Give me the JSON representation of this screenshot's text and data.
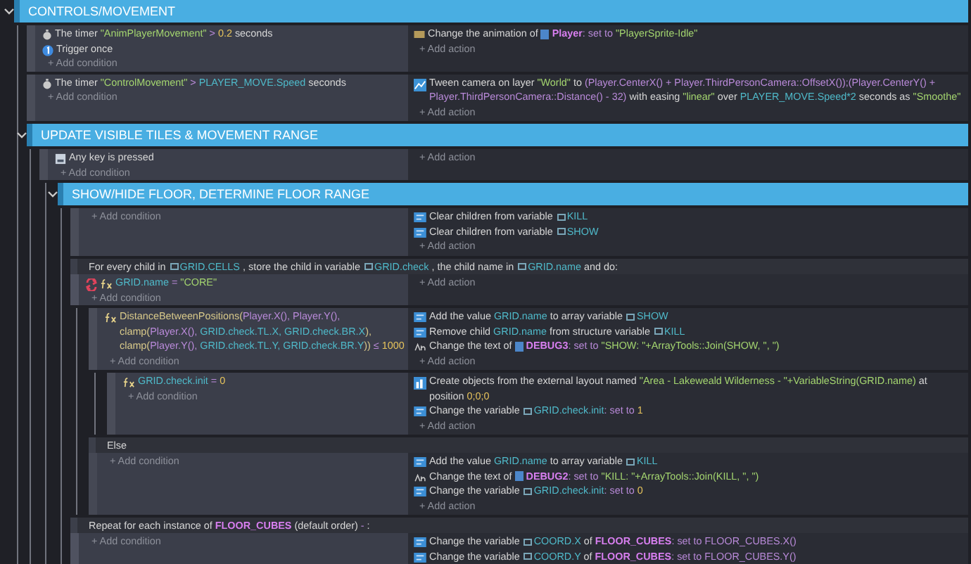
{
  "events": [
    {
      "kind": "group",
      "title": "CONTROLS/MOVEMENT",
      "expanded": true,
      "children": [
        {
          "kind": "event",
          "add_condition": "+ Add condition",
          "add_action": "+ Add action",
          "conditions": [
            {
              "kind": "timer",
              "inverted": false,
              "parts": [
                {
                  "kind": "text",
                  "text": "The timer "
                },
                {
                  "kind": "string",
                  "text": "\"AnimPlayerMovement\""
                },
                {
                  "kind": "operator",
                  "text": " > "
                },
                {
                  "kind": "number",
                  "text": "0.2"
                },
                {
                  "kind": "text",
                  "text": " seconds"
                }
              ]
            },
            {
              "kind": "trigger",
              "inverted": false,
              "parts": [
                {
                  "kind": "text",
                  "text": "Trigger once"
                }
              ]
            }
          ],
          "actions": [
            {
              "kind": "animation",
              "parts": [
                {
                  "kind": "text",
                  "text": "Change the animation of "
                },
                {
                  "kind": "objref",
                  "text": "Player"
                },
                {
                  "kind": "operator",
                  "text": ": set to "
                },
                {
                  "kind": "string",
                  "text": "\"PlayerSprite-Idle\""
                }
              ]
            }
          ]
        },
        {
          "kind": "event",
          "add_condition": "+ Add condition",
          "add_action": "+ Add action",
          "conditions": [
            {
              "kind": "timer",
              "inverted": false,
              "parts": [
                {
                  "kind": "text",
                  "text": "The timer "
                },
                {
                  "kind": "string",
                  "text": "\"ControlMovement\""
                },
                {
                  "kind": "operator",
                  "text": " > "
                },
                {
                  "kind": "variable",
                  "text": "PLAYER_MOVE.Speed"
                },
                {
                  "kind": "text",
                  "text": " seconds"
                }
              ]
            }
          ],
          "actions": [
            {
              "kind": "tween",
              "parts": [
                {
                  "kind": "text",
                  "text": "Tween camera on layer "
                },
                {
                  "kind": "string",
                  "text": "\"World\""
                },
                {
                  "kind": "text",
                  "text": " to "
                },
                {
                  "kind": "expression",
                  "text": "(Player.CenterX() + Player.ThirdPersonCamera::OffsetX());(Player.CenterY() + Player.ThirdPersonCamera::Distance() - 32)"
                },
                {
                  "kind": "text",
                  "text": " with easing "
                },
                {
                  "kind": "string",
                  "text": "\"linear\""
                },
                {
                  "kind": "text",
                  "text": " over "
                },
                {
                  "kind": "variable",
                  "text": "PLAYER_MOVE.Speed*2"
                },
                {
                  "kind": "text",
                  "text": " seconds as "
                },
                {
                  "kind": "string",
                  "text": "\"Smoothe\""
                }
              ]
            }
          ]
        },
        {
          "kind": "group",
          "title": "UPDATE VISIBLE TILES & MOVEMENT RANGE",
          "expanded": true,
          "children": [
            {
              "kind": "event",
              "add_condition": "+ Add condition",
              "add_action": "+ Add action",
              "conditions": [
                {
                  "kind": "key",
                  "inverted": false,
                  "parts": [
                    {
                      "kind": "text",
                      "text": "Any key is pressed"
                    }
                  ]
                }
              ],
              "children": [
                {
                  "kind": "group",
                  "title": "SHOW/HIDE FLOOR, DETERMINE FLOOR RANGE",
                  "expanded": true,
                  "children": [
                    {
                      "kind": "event",
                      "add_condition": "+ Add condition",
                      "add_action": "+ Add action",
                      "actions": [
                        {
                          "kind": "variable",
                          "parts": [
                            {
                              "kind": "text",
                              "text": "Clear children from variable "
                            },
                            {
                              "kind": "varref",
                              "text": "KILL"
                            }
                          ]
                        },
                        {
                          "kind": "variable",
                          "parts": [
                            {
                              "kind": "text",
                              "text": "Clear children from variable "
                            },
                            {
                              "kind": "varref",
                              "text": "SHOW"
                            }
                          ]
                        }
                      ]
                    },
                    {
                      "kind": "loop",
                      "add_condition": "+ Add condition",
                      "add_action": "+ Add action",
                      "header": [
                        {
                          "kind": "text",
                          "text": "For every child in "
                        },
                        {
                          "kind": "varref",
                          "text": "GRID.CELLS"
                        },
                        {
                          "kind": "text",
                          "text": " , store the child in variable "
                        },
                        {
                          "kind": "varref",
                          "text": "GRID.check"
                        },
                        {
                          "kind": "text",
                          "text": " , the child name in "
                        },
                        {
                          "kind": "varref",
                          "text": "GRID.name"
                        },
                        {
                          "kind": "text",
                          "text": " and do:"
                        }
                      ],
                      "conditions": [
                        {
                          "kind": "expression",
                          "inverted": true,
                          "parts": [
                            {
                              "kind": "variable",
                              "text": "GRID.name"
                            },
                            {
                              "kind": "operator",
                              "text": " = "
                            },
                            {
                              "kind": "string",
                              "text": "\"CORE\""
                            }
                          ]
                        }
                      ],
                      "children": [
                        {
                          "kind": "event",
                          "add_condition": "+ Add condition",
                          "add_action": "+ Add action",
                          "conditions": [
                            {
                              "kind": "expression",
                              "inverted": false,
                              "parts": [
                                {
                                  "kind": "function",
                                  "text": "DistanceBetweenPositions("
                                },
                                {
                                  "kind": "expression",
                                  "text": "Player.X(), Player.Y(), "
                                },
                                {
                                  "kind": "function",
                                  "text": "clamp("
                                },
                                {
                                  "kind": "expression",
                                  "text": "Player.X(), "
                                },
                                {
                                  "kind": "variable",
                                  "text": "GRID.check.TL.X, GRID.check.BR.X"
                                },
                                {
                                  "kind": "function",
                                  "text": "), clamp("
                                },
                                {
                                  "kind": "expression",
                                  "text": "Player.Y(), "
                                },
                                {
                                  "kind": "variable",
                                  "text": "GRID.check.TL.Y, GRID.check.BR.Y"
                                },
                                {
                                  "kind": "function",
                                  "text": "))"
                                },
                                {
                                  "kind": "operator",
                                  "text": " ≤ "
                                },
                                {
                                  "kind": "number",
                                  "text": "1000"
                                }
                              ]
                            }
                          ],
                          "actions": [
                            {
                              "kind": "variable",
                              "parts": [
                                {
                                  "kind": "text",
                                  "text": "Add the value "
                                },
                                {
                                  "kind": "variable",
                                  "text": "GRID.name"
                                },
                                {
                                  "kind": "text",
                                  "text": " to array variable "
                                },
                                {
                                  "kind": "varref",
                                  "text": "SHOW"
                                }
                              ]
                            },
                            {
                              "kind": "variable",
                              "parts": [
                                {
                                  "kind": "text",
                                  "text": "Remove child "
                                },
                                {
                                  "kind": "variable",
                                  "text": "GRID.name"
                                },
                                {
                                  "kind": "text",
                                  "text": " from structure variable "
                                },
                                {
                                  "kind": "varref",
                                  "text": "KILL"
                                }
                              ]
                            },
                            {
                              "kind": "text",
                              "parts": [
                                {
                                  "kind": "text",
                                  "text": "Change the text of "
                                },
                                {
                                  "kind": "objref",
                                  "text": "DEBUG3"
                                },
                                {
                                  "kind": "operator",
                                  "text": ": set to "
                                },
                                {
                                  "kind": "string",
                                  "text": "\"SHOW: \"+ArrayTools::Join(SHOW, \", \")"
                                }
                              ]
                            }
                          ],
                          "children": [
                            {
                              "kind": "event",
                              "add_condition": "+ Add condition",
                              "add_action": "+ Add action",
                              "conditions": [
                                {
                                  "kind": "expression",
                                  "inverted": false,
                                  "parts": [
                                    {
                                      "kind": "variable",
                                      "text": "GRID.check.init"
                                    },
                                    {
                                      "kind": "operator",
                                      "text": " = "
                                    },
                                    {
                                      "kind": "number",
                                      "text": "0"
                                    }
                                  ]
                                }
                              ],
                              "actions": [
                                {
                                  "kind": "create",
                                  "parts": [
                                    {
                                      "kind": "text",
                                      "text": "Create objects from the external layout named "
                                    },
                                    {
                                      "kind": "string",
                                      "text": "\"Area - Lakeweald Wilderness - \"+VariableString(GRID.name)"
                                    },
                                    {
                                      "kind": "text",
                                      "text": " at position "
                                    },
                                    {
                                      "kind": "number",
                                      "text": "0;0;0"
                                    }
                                  ]
                                },
                                {
                                  "kind": "variable",
                                  "parts": [
                                    {
                                      "kind": "text",
                                      "text": "Change the variable "
                                    },
                                    {
                                      "kind": "varref",
                                      "text": "GRID.check.init"
                                    },
                                    {
                                      "kind": "operator",
                                      "text": ": set to "
                                    },
                                    {
                                      "kind": "number",
                                      "text": "1"
                                    }
                                  ]
                                }
                              ]
                            }
                          ]
                        },
                        {
                          "kind": "else",
                          "add_condition": "+ Add condition",
                          "add_action": "+ Add action",
                          "header": [
                            {
                              "kind": "text",
                              "text": "Else"
                            }
                          ],
                          "actions": [
                            {
                              "kind": "variable",
                              "parts": [
                                {
                                  "kind": "text",
                                  "text": "Add the value "
                                },
                                {
                                  "kind": "variable",
                                  "text": "GRID.name"
                                },
                                {
                                  "kind": "text",
                                  "text": " to array variable "
                                },
                                {
                                  "kind": "varref",
                                  "text": "KILL"
                                }
                              ]
                            },
                            {
                              "kind": "text",
                              "parts": [
                                {
                                  "kind": "text",
                                  "text": "Change the text of "
                                },
                                {
                                  "kind": "objref",
                                  "text": "DEBUG2"
                                },
                                {
                                  "kind": "operator",
                                  "text": ": set to "
                                },
                                {
                                  "kind": "string",
                                  "text": "\"KILL: \"+ArrayTools::Join(KILL, \", \")"
                                }
                              ]
                            },
                            {
                              "kind": "variable",
                              "parts": [
                                {
                                  "kind": "text",
                                  "text": "Change the variable "
                                },
                                {
                                  "kind": "varref",
                                  "text": "GRID.check.init"
                                },
                                {
                                  "kind": "operator",
                                  "text": ": set to "
                                },
                                {
                                  "kind": "number",
                                  "text": "0"
                                }
                              ]
                            }
                          ]
                        }
                      ]
                    },
                    {
                      "kind": "loop",
                      "add_condition": "+ Add condition",
                      "header": [
                        {
                          "kind": "text",
                          "text": "Repeat for each instance of "
                        },
                        {
                          "kind": "object",
                          "text": "FLOOR_CUBES"
                        },
                        {
                          "kind": "text",
                          "text": " (default order) "
                        },
                        {
                          "kind": "operator",
                          "text": "-"
                        },
                        {
                          "kind": "text",
                          "text": " :"
                        }
                      ],
                      "actions": [
                        {
                          "kind": "variable",
                          "parts": [
                            {
                              "kind": "text",
                              "text": "Change the variable "
                            },
                            {
                              "kind": "varref",
                              "text": "COORD.X"
                            },
                            {
                              "kind": "text",
                              "text": " of "
                            },
                            {
                              "kind": "object",
                              "text": "FLOOR_CUBES"
                            },
                            {
                              "kind": "operator",
                              "text": ": set to "
                            },
                            {
                              "kind": "expression",
                              "text": "FLOOR_CUBES.X()"
                            }
                          ]
                        },
                        {
                          "kind": "variable",
                          "parts": [
                            {
                              "kind": "text",
                              "text": "Change the variable "
                            },
                            {
                              "kind": "varref",
                              "text": "COORD.Y"
                            },
                            {
                              "kind": "text",
                              "text": " of "
                            },
                            {
                              "kind": "object",
                              "text": "FLOOR_CUBES"
                            },
                            {
                              "kind": "operator",
                              "text": ": set to "
                            },
                            {
                              "kind": "expression",
                              "text": "FLOOR_CUBES.Y()"
                            }
                          ]
                        }
                      ]
                    }
                  ]
                }
              ]
            }
          ]
        }
      ]
    }
  ]
}
